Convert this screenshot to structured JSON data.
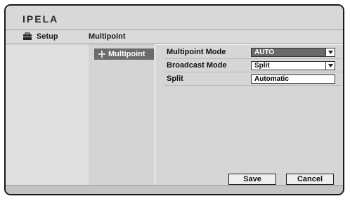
{
  "brand": "IPELA",
  "header": {
    "setup_label": "Setup",
    "breadcrumb": "Multipoint"
  },
  "nav": {
    "items": [
      {
        "label": "Multipoint",
        "icon": "settings-icon",
        "selected": true
      }
    ]
  },
  "form": {
    "multipoint_mode": {
      "label": "Multipoint Mode",
      "value": "AUTO"
    },
    "broadcast_mode": {
      "label": "Broadcast Mode",
      "value": "Split"
    },
    "split": {
      "label": "Split",
      "value": "Automatic"
    }
  },
  "buttons": {
    "save": "Save",
    "cancel": "Cancel"
  }
}
